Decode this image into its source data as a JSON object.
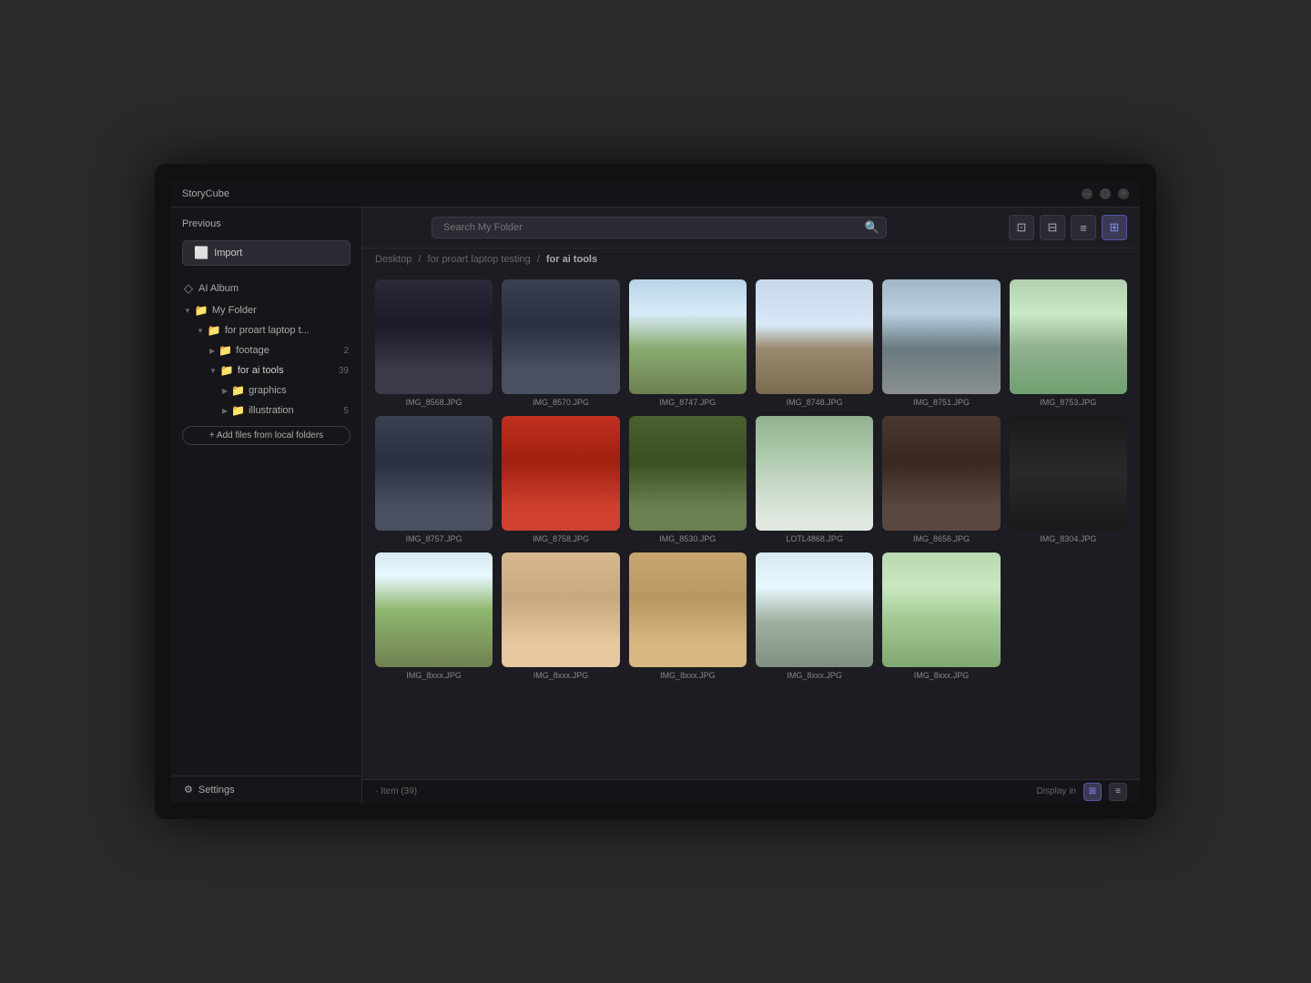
{
  "app": {
    "name": "StoryCube",
    "title_bar_buttons": {
      "minimize": "—",
      "restore": "❐",
      "close": "✕"
    }
  },
  "sidebar": {
    "previous_label": "Previous",
    "import_label": "Import",
    "ai_album_label": "AI Album",
    "my_folder_label": "My Folder",
    "folder_tree": {
      "root": "for proart laptop t...",
      "footage": "footage",
      "footage_count": "2",
      "for_ai_tools": "for ai tools",
      "for_ai_tools_count": "39",
      "graphics": "graphics",
      "illustration": "illustration",
      "illustration_count": "5"
    },
    "add_files_label": "+ Add files from local folders",
    "settings_label": "Settings"
  },
  "toolbar": {
    "search_placeholder": "Search My Folder",
    "btn_monitor": "⊡",
    "btn_filter": "⊟",
    "btn_sort": "≡",
    "btn_grid": "⊞"
  },
  "breadcrumb": {
    "parts": [
      "Desktop",
      "for proart laptop testing",
      "for ai tools"
    ],
    "separator": "/"
  },
  "photos": [
    {
      "id": "p1",
      "label": "IMG_8568.JPG",
      "scene": "scene-dark"
    },
    {
      "id": "p2",
      "label": "IMG_8570.JPG",
      "scene": "scene-car"
    },
    {
      "id": "p3",
      "label": "IMG_8747.JPG",
      "scene": "scene-village"
    },
    {
      "id": "p4",
      "label": "IMG_8748.JPG",
      "scene": "scene-street"
    },
    {
      "id": "p5",
      "label": "IMG_8751.JPG",
      "scene": "scene-crowd"
    },
    {
      "id": "p6",
      "label": "IMG_8753.JPG",
      "scene": "scene-bridge"
    },
    {
      "id": "p7",
      "label": "IMG_8757.JPG",
      "scene": "scene-car"
    },
    {
      "id": "p8",
      "label": "IMG_8758.JPG",
      "scene": "scene-bp"
    },
    {
      "id": "p9",
      "label": "IMG_8530.JPG",
      "scene": "scene-garden"
    },
    {
      "id": "p10",
      "label": "LOTL4868.JPG",
      "scene": "scene-fence"
    },
    {
      "id": "p11",
      "label": "IMG_8656.JPG",
      "scene": "scene-pub"
    },
    {
      "id": "p12",
      "label": "IMG_8304.JPG",
      "scene": "scene-speaker"
    },
    {
      "id": "p13",
      "label": "IMG_8xxx.JPG",
      "scene": "scene-football"
    },
    {
      "id": "p14",
      "label": "IMG_8xxx.JPG",
      "scene": "scene-dog"
    },
    {
      "id": "p15",
      "label": "IMG_8xxx.JPG",
      "scene": "scene-dog2"
    },
    {
      "id": "p16",
      "label": "IMG_8xxx.JPG",
      "scene": "scene-cathedral"
    },
    {
      "id": "p17",
      "label": "IMG_8xxx.JPG",
      "scene": "scene-lawn"
    }
  ],
  "status_bar": {
    "item_count": "· Item (39)",
    "display_in_label": "Display in"
  }
}
